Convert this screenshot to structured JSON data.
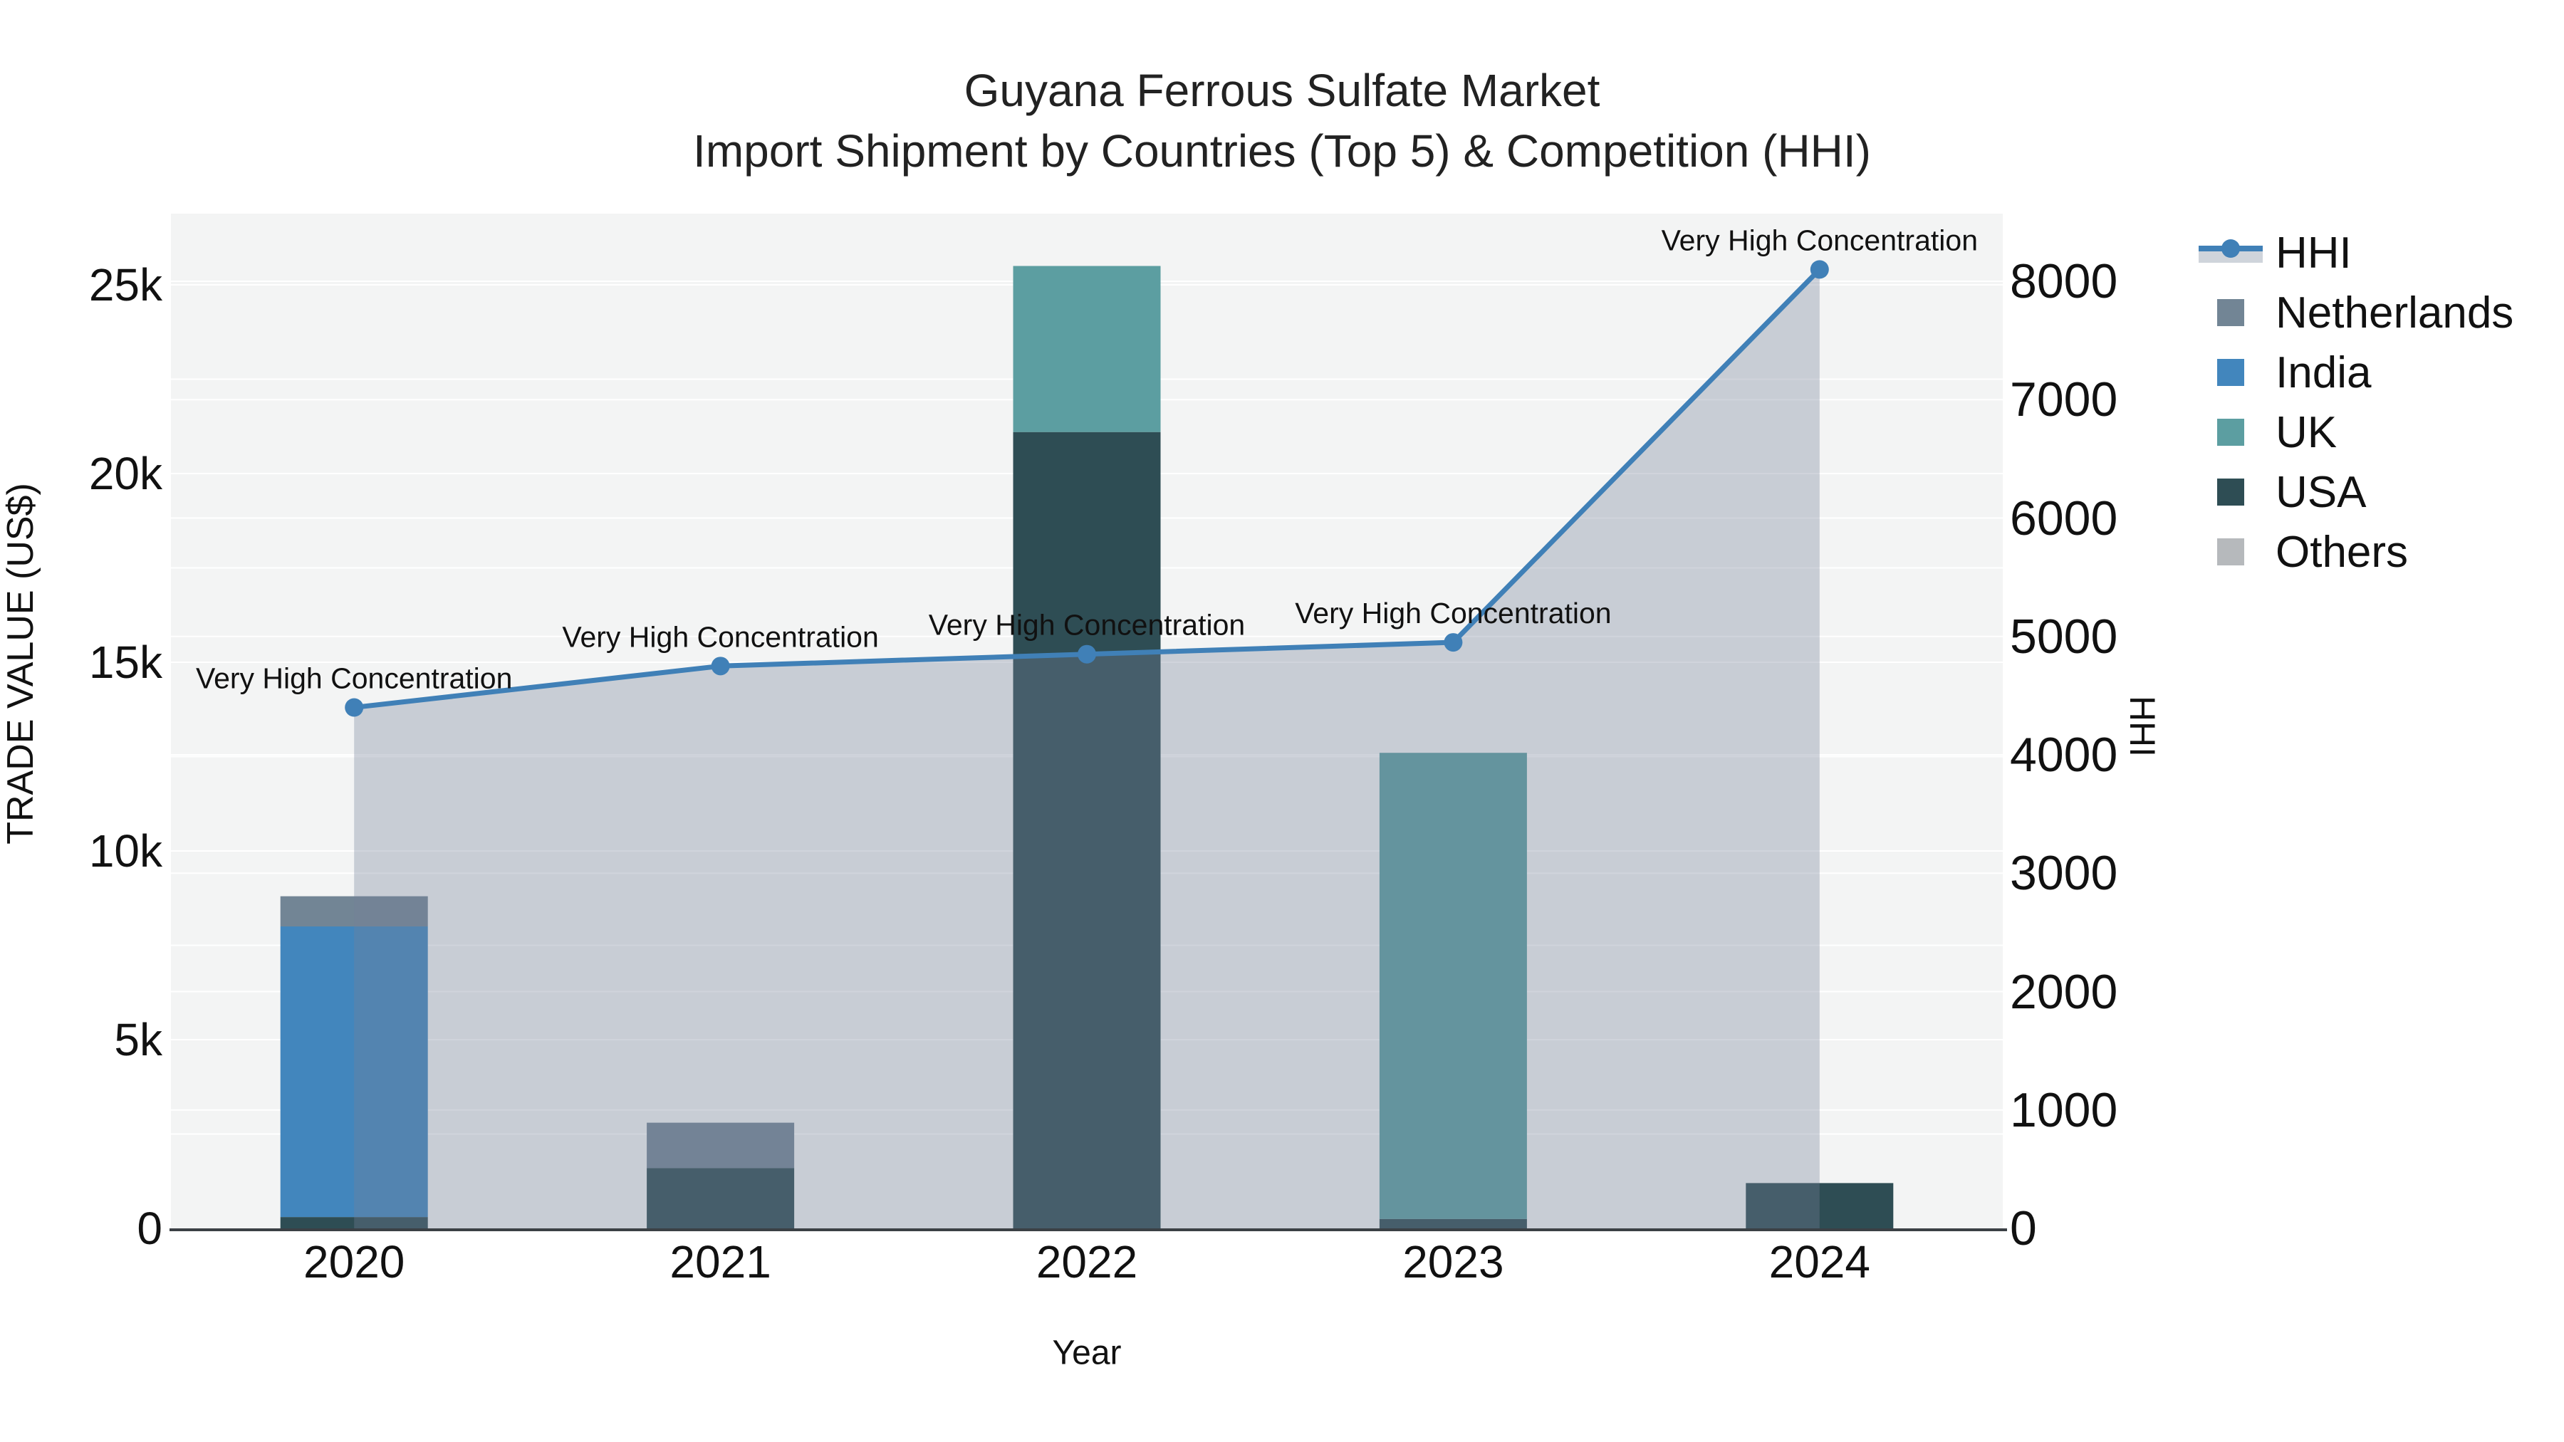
{
  "title": {
    "line1": "Guyana Ferrous Sulfate Market",
    "line2": "Import Shipment by Countries (Top 5) & Competition (HHI)"
  },
  "chart_data": {
    "type": "combo-stacked-bar-line",
    "title": "Guyana Ferrous Sulfate Market Import Shipment by Countries (Top 5) & Competition (HHI)",
    "categories": [
      "2020",
      "2021",
      "2022",
      "2023",
      "2024"
    ],
    "x_axis": {
      "title": "Year"
    },
    "left_axis": {
      "title": "TRADE VALUE (US$)",
      "tick_labels": [
        "0",
        "5k",
        "10k",
        "15k",
        "20k",
        "25k"
      ],
      "tick_values": [
        0,
        5000,
        10000,
        15000,
        20000,
        25000
      ],
      "minor_gridline_step": 2500,
      "ylim": [
        0,
        26900
      ]
    },
    "right_axis": {
      "title": "HHI",
      "tick_labels": [
        "0",
        "1000",
        "2000",
        "3000",
        "4000",
        "5000",
        "6000",
        "7000",
        "8000"
      ],
      "tick_values": [
        0,
        1000,
        2000,
        3000,
        4000,
        5000,
        6000,
        7000,
        8000
      ],
      "ylim": [
        0,
        8570
      ]
    },
    "bar_series": [
      {
        "name": "USA",
        "color": "#2e4d54",
        "values": [
          300,
          1600,
          21100,
          250,
          1200
        ]
      },
      {
        "name": "India",
        "color": "#4286bd",
        "values": [
          7700,
          0,
          0,
          0,
          0
        ]
      },
      {
        "name": "UK",
        "color": "#5c9ea1",
        "values": [
          0,
          0,
          4400,
          12350,
          0
        ]
      },
      {
        "name": "Netherlands",
        "color": "#728595",
        "values": [
          800,
          1200,
          0,
          0,
          0
        ]
      },
      {
        "name": "Others",
        "color": "#b6b9bc",
        "values": [
          0,
          0,
          0,
          0,
          0
        ]
      }
    ],
    "bar_totals": [
      8800,
      2800,
      25500,
      12600,
      1200
    ],
    "line_series": {
      "name": "HHI",
      "axis": "right",
      "color": "#4080b7",
      "area_fill": "rgba(118,130,152,0.34)",
      "values": [
        4400,
        4750,
        4850,
        4950,
        8100
      ]
    },
    "annotations": [
      {
        "category": "2020",
        "text": "Very High Concentration"
      },
      {
        "category": "2021",
        "text": "Very High Concentration"
      },
      {
        "category": "2022",
        "text": "Very High Concentration"
      },
      {
        "category": "2023",
        "text": "Very High Concentration"
      },
      {
        "category": "2024",
        "text": "Very High Concentration"
      }
    ],
    "layout_hints": {
      "legend_position": "right",
      "grid": true,
      "plot_background": "#f3f4f4",
      "gridline_color": "#ffffff",
      "axis_line_color": "#3b4045",
      "stack_order_bottom_to_top": [
        "USA",
        "India",
        "UK",
        "Netherlands",
        "Others"
      ]
    }
  },
  "legend": {
    "items": [
      {
        "label": "HHI",
        "type": "line",
        "color": "#4080b7",
        "band_color": "#cfd4db"
      },
      {
        "label": "Netherlands",
        "type": "swatch",
        "color": "#728595"
      },
      {
        "label": "India",
        "type": "swatch",
        "color": "#4286bd"
      },
      {
        "label": "UK",
        "type": "swatch",
        "color": "#5c9ea1"
      },
      {
        "label": "USA",
        "type": "swatch",
        "color": "#2e4d54"
      },
      {
        "label": "Others",
        "type": "swatch",
        "color": "#b6b9bc"
      }
    ]
  }
}
